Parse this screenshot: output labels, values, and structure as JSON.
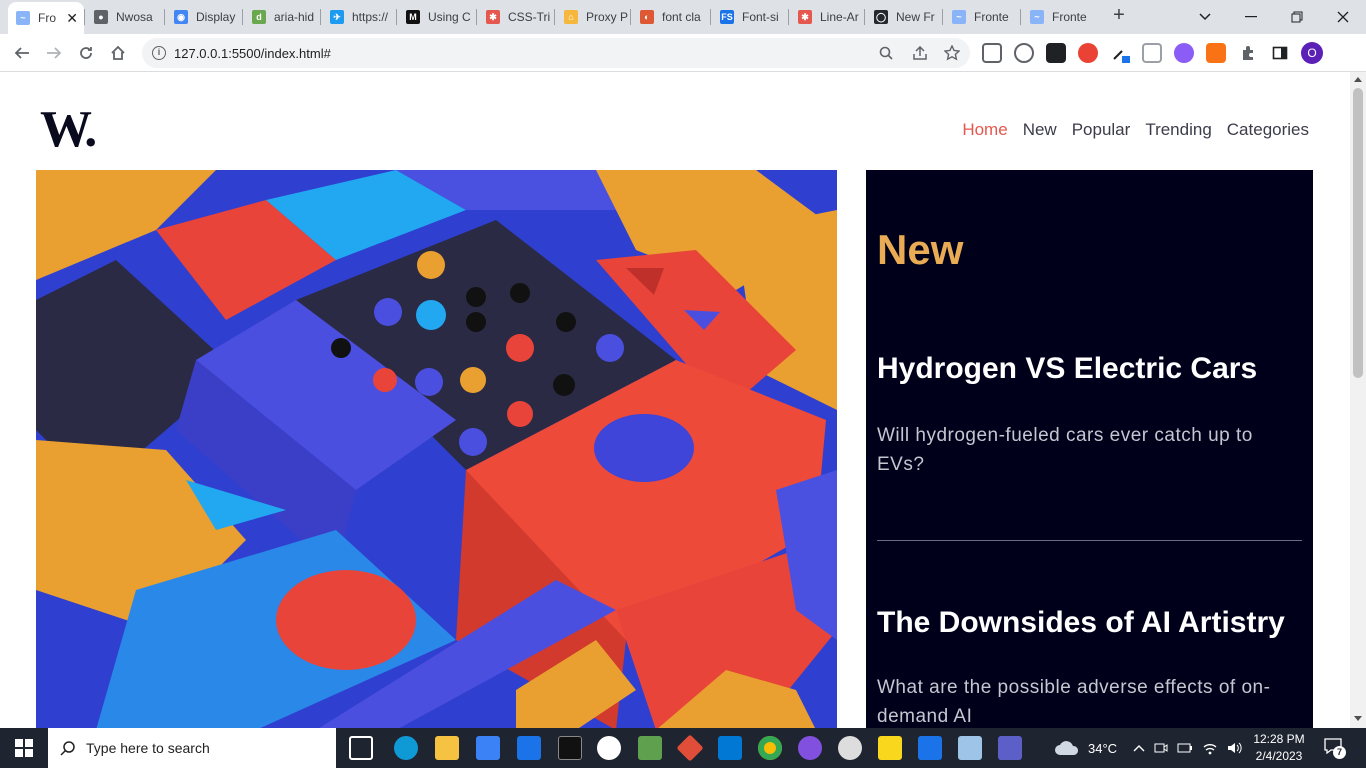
{
  "browser": {
    "tabs": [
      {
        "label": "Fro",
        "color": "#8ab4f8",
        "glyph": "~"
      },
      {
        "label": "Nwosa",
        "color": "#5f6368",
        "glyph": "●"
      },
      {
        "label": "Display",
        "color": "#4285f4",
        "glyph": "◉"
      },
      {
        "label": "aria-hid",
        "color": "#6aa84f",
        "glyph": "d"
      },
      {
        "label": "https://",
        "color": "#1d9bf0",
        "glyph": "✈"
      },
      {
        "label": "Using C",
        "color": "#111111",
        "glyph": "M"
      },
      {
        "label": "CSS-Tri",
        "color": "#e5584f",
        "glyph": "✱"
      },
      {
        "label": "Proxy P",
        "color": "#f6b73c",
        "glyph": "⌂"
      },
      {
        "label": "font cla",
        "color": "#de5833",
        "glyph": "◐"
      },
      {
        "label": "Font-si",
        "color": "#1a73e8",
        "glyph": "FS"
      },
      {
        "label": "Line-Ar",
        "color": "#e5584f",
        "glyph": "✱"
      },
      {
        "label": "New Fr",
        "color": "#24292f",
        "glyph": "◯"
      },
      {
        "label": "Fronte",
        "color": "#8ab4f8",
        "glyph": "~"
      },
      {
        "label": "Fronte",
        "color": "#8ab4f8",
        "glyph": "~"
      }
    ],
    "new_tab": "+",
    "url": "127.0.0.1:5500/index.html#"
  },
  "site": {
    "logo": "W.",
    "nav": [
      "Home",
      "New",
      "Popular",
      "Trending",
      "Categories"
    ],
    "panel_title": "New",
    "articles": [
      {
        "title": "Hydrogen VS Electric Cars",
        "desc": "Will hydrogen-fueled cars ever catch up to EVs?"
      },
      {
        "title": "The Downsides of AI Artistry",
        "desc": "What are the possible adverse effects of on-demand AI"
      }
    ],
    "accent": "#e9ab53",
    "nav_active_color": "#e5584f",
    "panel_bg": "#00001a"
  },
  "taskbar": {
    "search_placeholder": "Type here to search",
    "weather": "34°C",
    "time": "12:28 PM",
    "date": "2/4/2023",
    "notification_count": "7"
  }
}
